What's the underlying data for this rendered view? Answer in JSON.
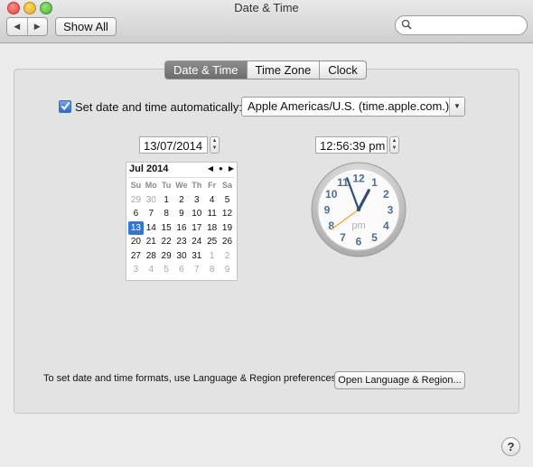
{
  "window": {
    "title": "Date & Time"
  },
  "toolbar": {
    "back_glyph": "◀",
    "forward_glyph": "▶",
    "show_all_label": "Show All",
    "search_placeholder": "",
    "search_icon": "search-icon"
  },
  "tabs": [
    {
      "label": "Date & Time",
      "selected": true
    },
    {
      "label": "Time Zone",
      "selected": false
    },
    {
      "label": "Clock",
      "selected": false
    }
  ],
  "auto": {
    "label": "Set date and time automatically:",
    "checked": true,
    "server": "Apple Americas/U.S. (time.apple.com.)"
  },
  "date_field": {
    "value": "13/07/2014"
  },
  "time_field": {
    "value": "12:56:39 pm"
  },
  "calendar": {
    "month_label": "Jul 2014",
    "nav": [
      "◀",
      "●",
      "▶"
    ],
    "weekdays": [
      "Su",
      "Mo",
      "Tu",
      "We",
      "Th",
      "Fr",
      "Sa"
    ],
    "weeks": [
      [
        "29",
        "30",
        "1",
        "2",
        "3",
        "4",
        "5"
      ],
      [
        "6",
        "7",
        "8",
        "9",
        "10",
        "11",
        "12"
      ],
      [
        "13",
        "14",
        "15",
        "16",
        "17",
        "18",
        "19"
      ],
      [
        "20",
        "21",
        "22",
        "23",
        "24",
        "25",
        "26"
      ],
      [
        "27",
        "28",
        "29",
        "30",
        "31",
        "1",
        "2"
      ],
      [
        "3",
        "4",
        "5",
        "6",
        "7",
        "8",
        "9"
      ]
    ],
    "selected_day": "13"
  },
  "clock": {
    "numbers": [
      "12",
      "1",
      "2",
      "3",
      "4",
      "5",
      "6",
      "7",
      "8",
      "9",
      "10",
      "11"
    ],
    "period": "pm",
    "hour": 12,
    "minute": 56,
    "second": 39,
    "hand_color": "#2d4f7a",
    "second_hand_color": "#f0a030"
  },
  "formats": {
    "label": "To set date and time formats, use Language & Region preferences.",
    "button": "Open Language & Region..."
  },
  "help": {
    "label": "?"
  },
  "colors": {
    "accent": "#2f78d8",
    "window_bg": "#ececec"
  }
}
